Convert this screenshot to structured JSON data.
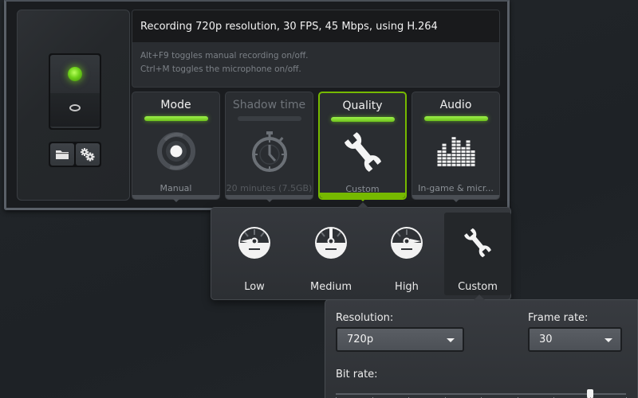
{
  "status": {
    "recording_line": "Recording 720p resolution, 30 FPS, 45 Mbps, using H.264",
    "hints": [
      "Alt+F9 toggles manual recording on/off.",
      "Ctrl+M toggles the microphone on/off."
    ]
  },
  "record_switch": {
    "state": "on",
    "led_color": "#76d11a"
  },
  "toolbar": {
    "buttons": [
      {
        "name": "open-folder",
        "icon": "folder-icon"
      },
      {
        "name": "settings",
        "icon": "gears-icon"
      }
    ]
  },
  "tiles": [
    {
      "title": "Mode",
      "subtitle": "Manual",
      "icon": "record-mode-icon",
      "enabled": true,
      "active": false
    },
    {
      "title": "Shadow time",
      "subtitle": "20 minutes (7.5GB)",
      "icon": "stopwatch-icon",
      "enabled": false,
      "active": false
    },
    {
      "title": "Quality",
      "subtitle": "Custom",
      "icon": "wrench-icon",
      "enabled": true,
      "active": true
    },
    {
      "title": "Audio",
      "subtitle": "In-game & micr...",
      "icon": "audio-equalizer-icon",
      "enabled": true,
      "active": false
    }
  ],
  "quality_presets": {
    "options": [
      {
        "label": "Low",
        "icon": "gauge-low-icon"
      },
      {
        "label": "Medium",
        "icon": "gauge-medium-icon"
      },
      {
        "label": "High",
        "icon": "gauge-high-icon"
      },
      {
        "label": "Custom",
        "icon": "wrench-icon"
      }
    ],
    "selected": "Custom"
  },
  "custom_settings": {
    "resolution_label": "Resolution:",
    "resolution_value": "720p",
    "frame_rate_label": "Frame rate:",
    "frame_rate_value": "30",
    "bit_rate_label": "Bit rate:",
    "bit_rate_fraction": 0.875,
    "bit_rate_ticks": 9
  },
  "colors": {
    "accent": "#76b900",
    "bar_glow": "#8ee63a",
    "background": "#202427"
  }
}
